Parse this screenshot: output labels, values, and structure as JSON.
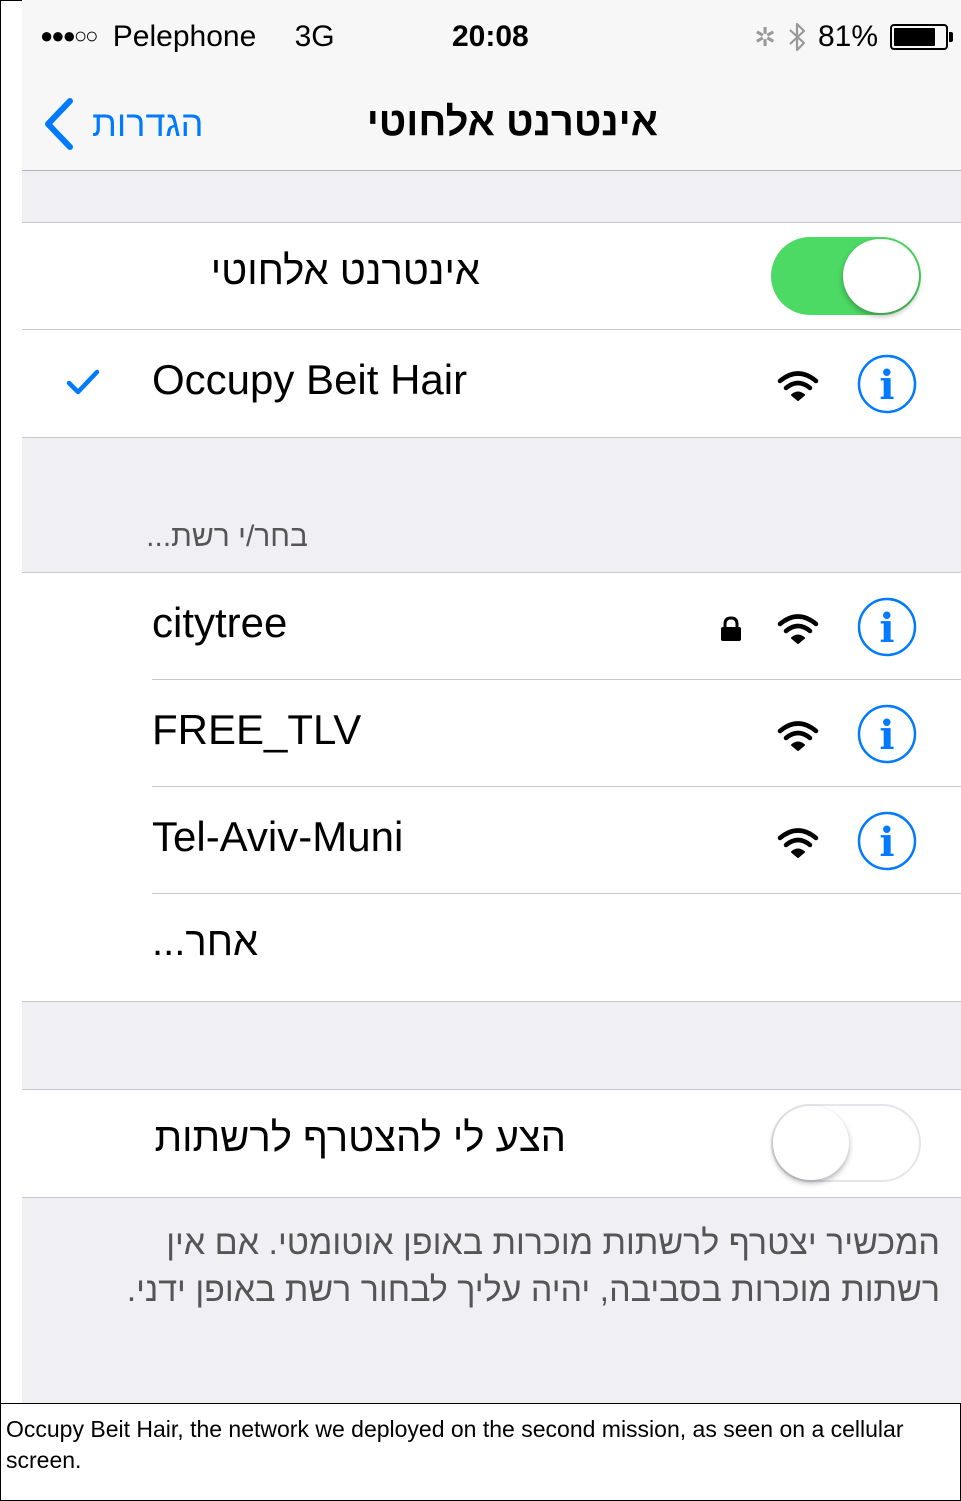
{
  "status_bar": {
    "signal_dots": "●●●○○",
    "carrier": "Pelephone",
    "network": "3G",
    "time": "20:08",
    "activity_icon": "activity-spinner",
    "bluetooth_icon": "bluetooth-icon",
    "battery_percent": "81%",
    "battery_level": 0.81
  },
  "nav": {
    "back_label": "הגדרות",
    "title": "אינטרנט אלחוטי"
  },
  "wifi_toggle": {
    "label": "אינטרנט אלחוטי",
    "on": true
  },
  "connected_network": {
    "name": "Occupy Beit Hair",
    "secured": false
  },
  "choose_network_header": "בחר/י רשת...",
  "networks": [
    {
      "name": "citytree",
      "secured": true
    },
    {
      "name": "FREE_TLV",
      "secured": false
    },
    {
      "name": "Tel-Aviv-Muni",
      "secured": false
    }
  ],
  "other_label": "אחר...",
  "ask_to_join": {
    "label": "הצע לי להצטרף לרשתות",
    "on": false
  },
  "footer_note": "המכשיר יצטרף לרשתות מוכרות באופן אוטומטי. אם אין רשתות מוכרות בסביבה, יהיה עליך לבחור רשת באופן ידני.",
  "caption": "Occupy Beit Hair, the network we deployed on the second mission, as seen on a cellular screen.",
  "colors": {
    "accent": "#007aff",
    "toggle_on": "#4cd964",
    "grouped_background": "#efeff4"
  }
}
